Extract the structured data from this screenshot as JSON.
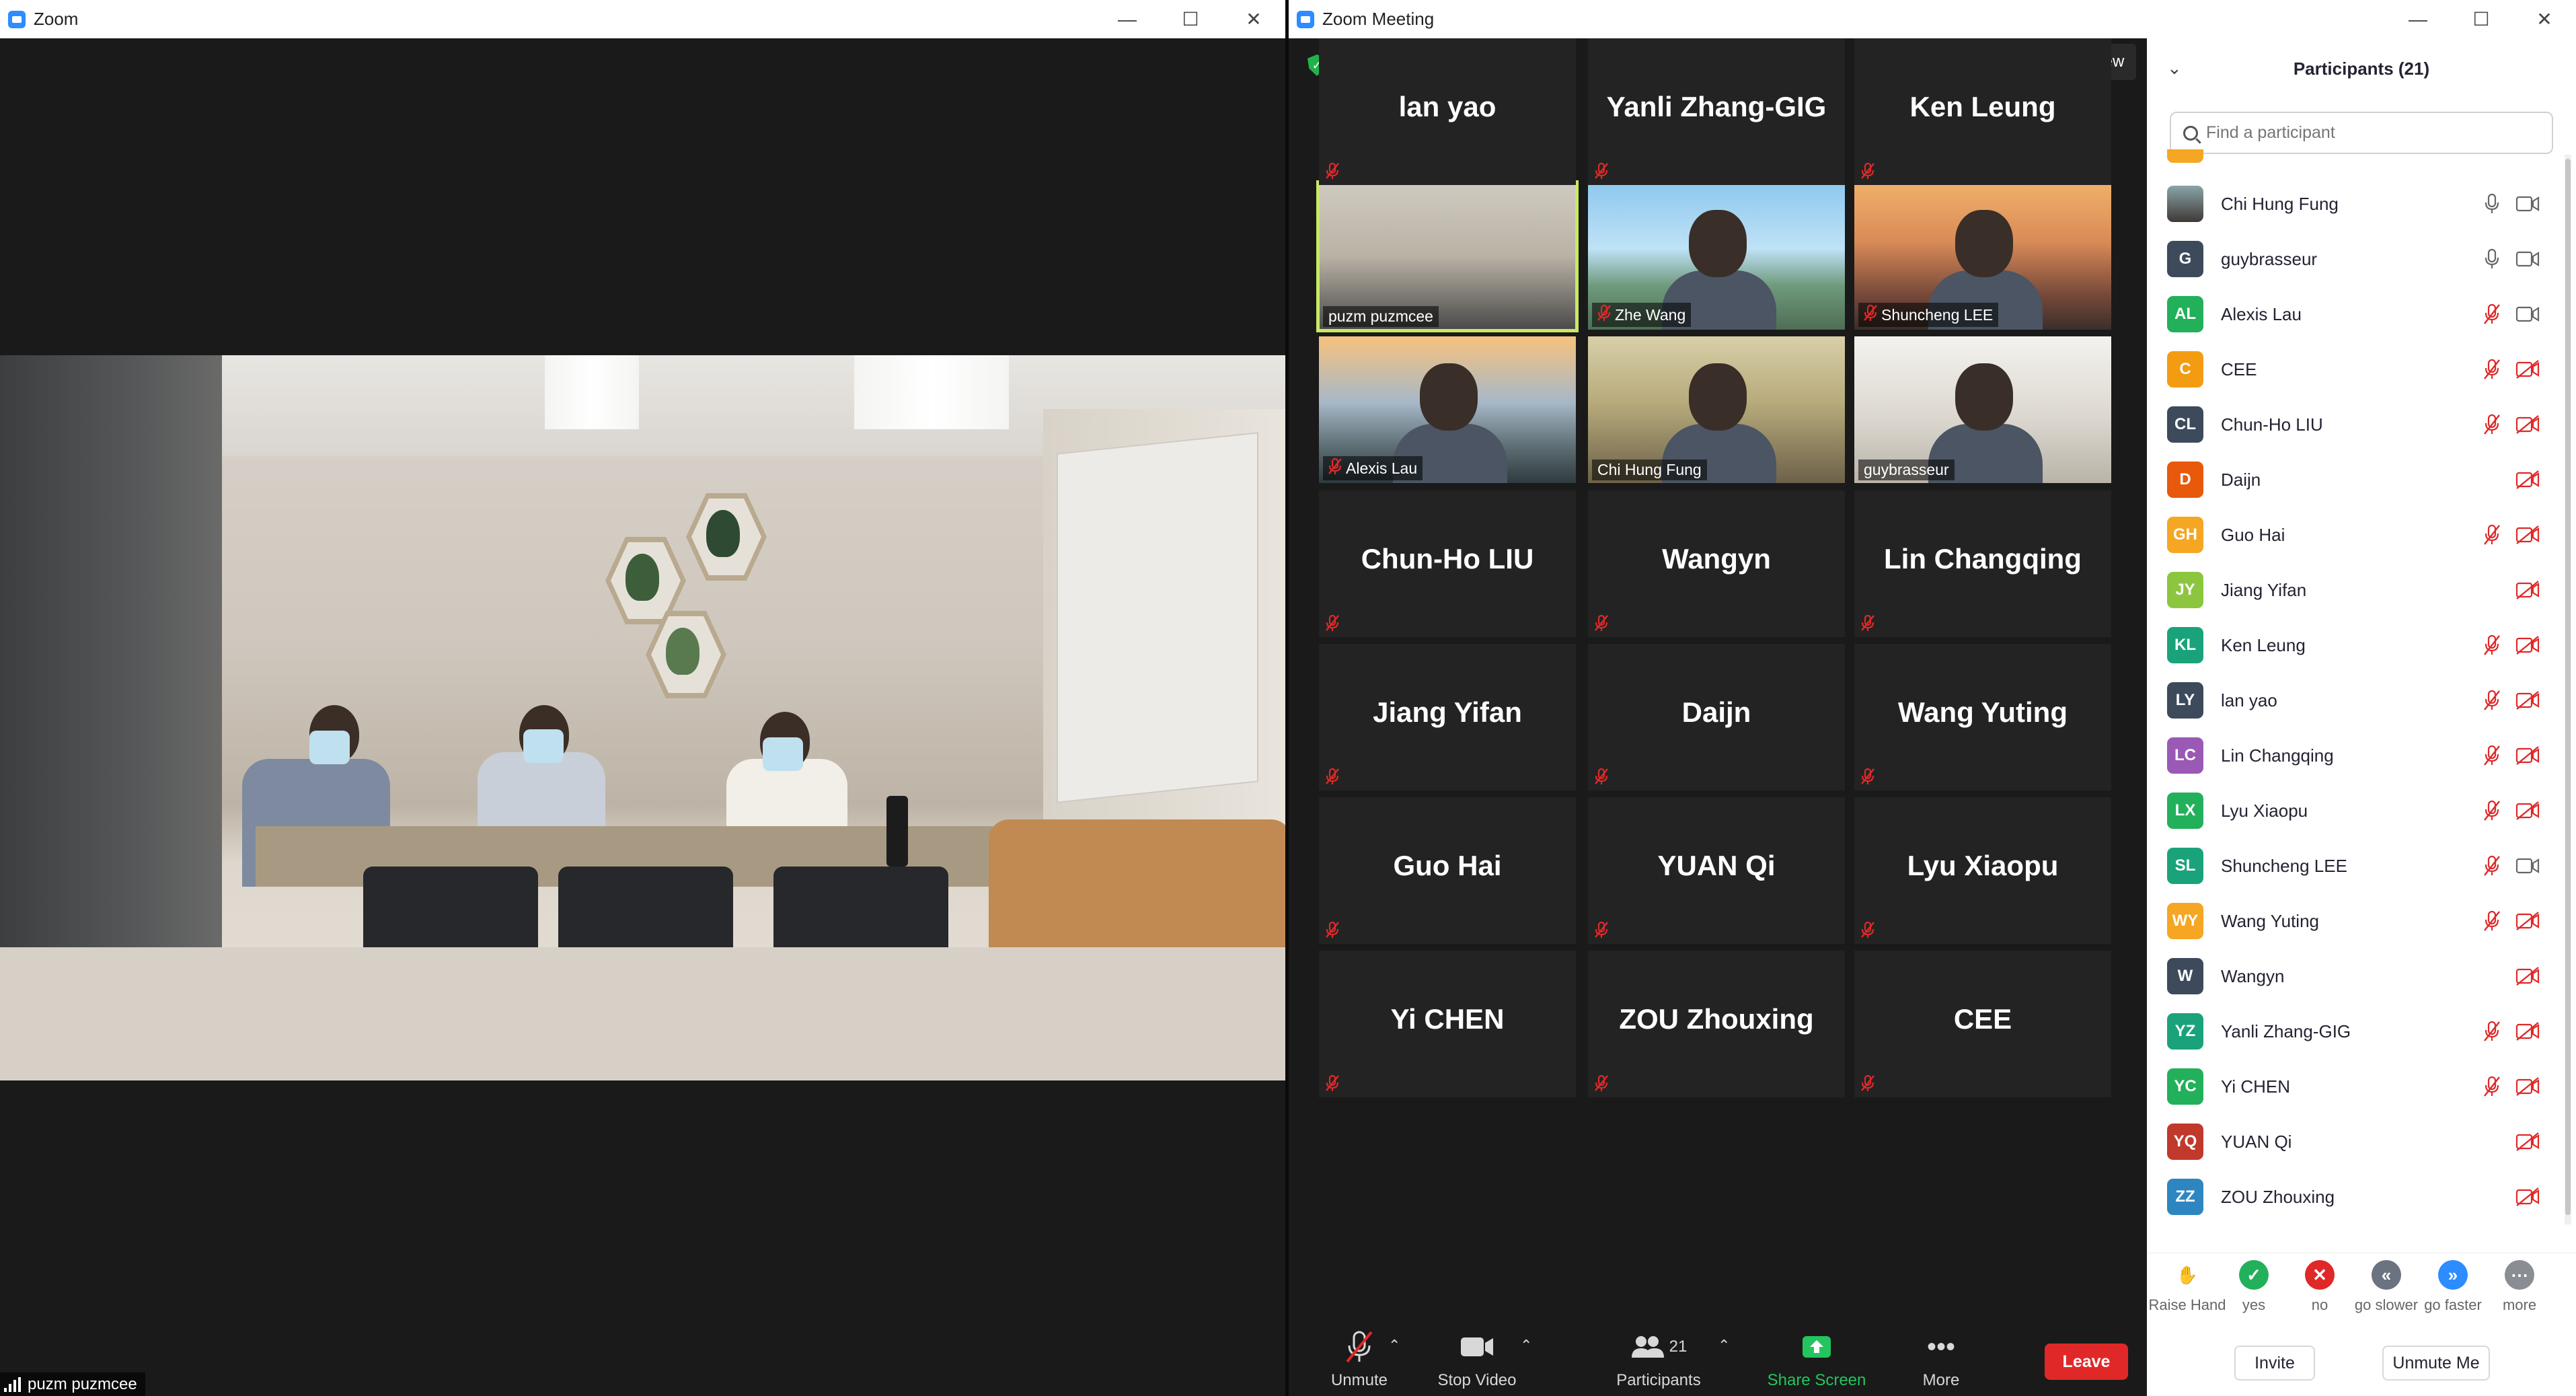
{
  "left_window": {
    "title": "Zoom",
    "speaker_name": "puzm puzmcee"
  },
  "right_window": {
    "title": "Zoom Meeting",
    "view_label": "View"
  },
  "gallery": {
    "video_tiles": [
      {
        "name": "puzm puzmcee",
        "muted": false,
        "active_speaker": true
      },
      {
        "name": "Zhe Wang",
        "muted": true
      },
      {
        "name": "Shuncheng LEE",
        "muted": true
      },
      {
        "name": "Alexis Lau",
        "muted": true
      },
      {
        "name": "Chi Hung Fung",
        "muted": false
      },
      {
        "name": "guybrasseur",
        "muted": false
      }
    ],
    "name_tiles": [
      "Chun-Ho LIU",
      "Wangyn",
      "Lin Changqing",
      "Jiang Yifan",
      "Daijn",
      "Wang Yuting",
      "Guo Hai",
      "YUAN Qi",
      "Lyu Xiaopu",
      "Yi CHEN",
      "ZOU Zhouxing",
      "CEE",
      "lan yao",
      "Yanli Zhang-GIG",
      "Ken Leung"
    ]
  },
  "toolbar": {
    "unmute": "Unmute",
    "stop_video": "Stop Video",
    "participants": "Participants",
    "participants_count": "21",
    "share_screen": "Share Screen",
    "more": "More",
    "leave": "Leave"
  },
  "panel": {
    "title": "Participants (21)",
    "search_placeholder": "Find a participant",
    "participants": [
      {
        "initials": "",
        "name": "Chi Hung Fung",
        "color": "#6b6b6b",
        "mic": "on",
        "cam": "on",
        "photo": true
      },
      {
        "initials": "G",
        "name": "guybrasseur",
        "color": "#3d4a5c",
        "mic": "on",
        "cam": "on"
      },
      {
        "initials": "AL",
        "name": "Alexis Lau",
        "color": "#23b05b",
        "mic": "off",
        "cam": "on"
      },
      {
        "initials": "C",
        "name": "CEE",
        "color": "#f39c12",
        "mic": "off",
        "cam": "off"
      },
      {
        "initials": "CL",
        "name": "Chun-Ho LIU",
        "color": "#3d4a5c",
        "mic": "off",
        "cam": "off"
      },
      {
        "initials": "D",
        "name": "Daijn",
        "color": "#e8590c",
        "mic": "none",
        "cam": "off"
      },
      {
        "initials": "GH",
        "name": "Guo Hai",
        "color": "#f5a623",
        "mic": "off",
        "cam": "off"
      },
      {
        "initials": "JY",
        "name": "Jiang Yifan",
        "color": "#8cc63f",
        "mic": "none",
        "cam": "off"
      },
      {
        "initials": "KL",
        "name": "Ken Leung",
        "color": "#1aa37a",
        "mic": "off",
        "cam": "off"
      },
      {
        "initials": "LY",
        "name": "lan yao",
        "color": "#3d4a5c",
        "mic": "off",
        "cam": "off"
      },
      {
        "initials": "LC",
        "name": "Lin Changqing",
        "color": "#9b59b6",
        "mic": "off",
        "cam": "off"
      },
      {
        "initials": "LX",
        "name": "Lyu Xiaopu",
        "color": "#23b05b",
        "mic": "off",
        "cam": "off"
      },
      {
        "initials": "SL",
        "name": "Shuncheng LEE",
        "color": "#1aa37a",
        "mic": "off",
        "cam": "on"
      },
      {
        "initials": "WY",
        "name": "Wang Yuting",
        "color": "#f5a623",
        "mic": "off",
        "cam": "off"
      },
      {
        "initials": "W",
        "name": "Wangyn",
        "color": "#3d4a5c",
        "mic": "none",
        "cam": "off"
      },
      {
        "initials": "YZ",
        "name": "Yanli Zhang-GIG",
        "color": "#1aa37a",
        "mic": "off",
        "cam": "off"
      },
      {
        "initials": "YC",
        "name": "Yi CHEN",
        "color": "#23b05b",
        "mic": "off",
        "cam": "off"
      },
      {
        "initials": "YQ",
        "name": "YUAN Qi",
        "color": "#c0392b",
        "mic": "none",
        "cam": "off"
      },
      {
        "initials": "ZZ",
        "name": "ZOU Zhouxing",
        "color": "#2e86c1",
        "mic": "none",
        "cam": "off"
      }
    ],
    "reactions": [
      {
        "label": "Raise Hand",
        "color": "#ffffff",
        "glyph": "✋"
      },
      {
        "label": "yes",
        "color": "#23b05b",
        "glyph": "✓"
      },
      {
        "label": "no",
        "color": "#e02828",
        "glyph": "✕"
      },
      {
        "label": "go slower",
        "color": "#6b7280",
        "glyph": "«"
      },
      {
        "label": "go faster",
        "color": "#2d8cff",
        "glyph": "»"
      },
      {
        "label": "more",
        "color": "#8a8d93",
        "glyph": "⋯"
      }
    ],
    "invite": "Invite",
    "unmute_me": "Unmute Me"
  },
  "colors": {
    "zoom_blue": "#2d8cff",
    "leave_red": "#e02828",
    "active_outline": "#c9e865",
    "share_green": "#23c55e"
  }
}
